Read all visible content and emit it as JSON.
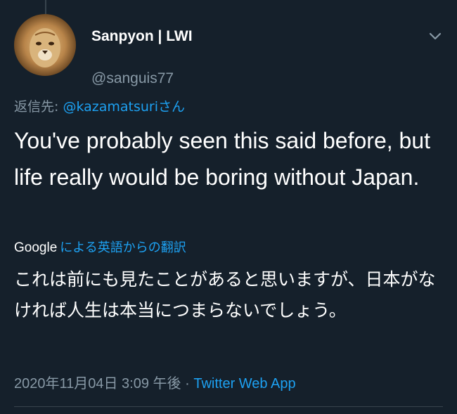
{
  "author": {
    "display_name": "Sanpyon | LWI",
    "handle": "@sanguis77",
    "avatar_icon": "lion-avatar-icon"
  },
  "reply": {
    "prefix": "返信先: ",
    "mention": "@kazamatsuri",
    "suffix": "さん"
  },
  "tweet": {
    "text": "You've probably seen this said before, but life really would be boring without Japan."
  },
  "translation": {
    "provider": "Google",
    "label": "による英語からの翻訳",
    "text": "これは前にも見たことがあると思いますが、日本がなければ人生は本当につまらないでしょう。"
  },
  "meta": {
    "timestamp": "2020年11月04日 3:09 午後",
    "separator": " · ",
    "app": "Twitter Web App"
  },
  "colors": {
    "background": "#15202b",
    "text": "#ffffff",
    "secondary": "#8899a6",
    "accent": "#1da1f2"
  }
}
